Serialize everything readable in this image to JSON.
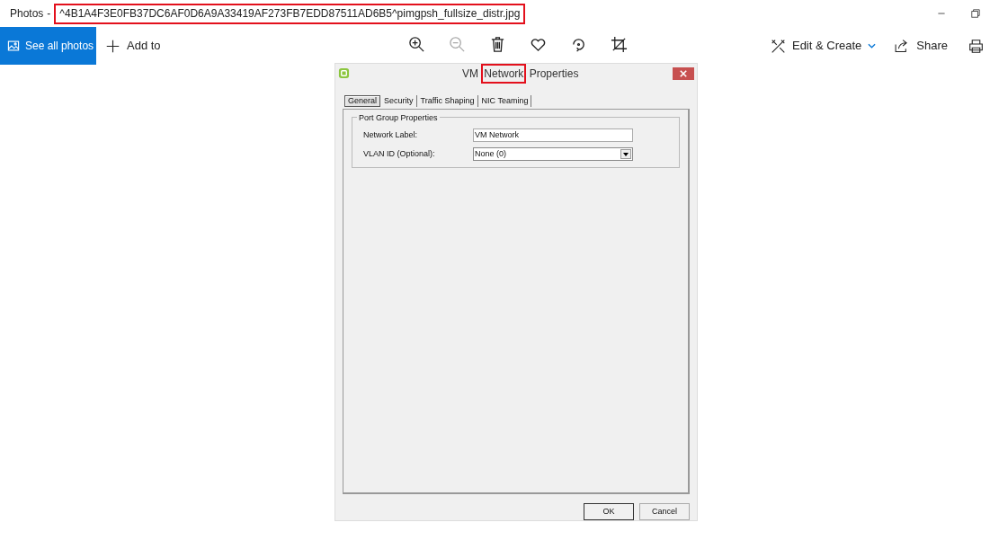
{
  "window": {
    "app": "Photos",
    "separator": "-",
    "filename": "^4B1A4F3E0FB37DC6AF0D6A9A33419AF273FB7EDD87511AD6B5^pimgpsh_fullsize_distr.jpg",
    "filename_highlighted": true
  },
  "toolbar": {
    "see_all": "See all photos",
    "add_to": "Add to",
    "edit_create": "Edit & Create",
    "share": "Share",
    "icons": [
      {
        "kind": "zoom-in",
        "disabled": false
      },
      {
        "kind": "zoom-out",
        "disabled": true
      },
      {
        "kind": "delete",
        "disabled": false
      },
      {
        "kind": "favorite",
        "disabled": false
      },
      {
        "kind": "rotate",
        "disabled": false
      },
      {
        "kind": "crop",
        "disabled": false
      }
    ]
  },
  "dialog": {
    "title_parts": [
      {
        "text": "VM ",
        "highlighted": false
      },
      {
        "text": "Network",
        "highlighted": true
      },
      {
        "text": " Properties",
        "highlighted": false
      }
    ],
    "tabs": [
      {
        "label": "General",
        "selected": true
      },
      {
        "label": "Security",
        "selected": false
      },
      {
        "label": "Traffic Shaping",
        "selected": false
      },
      {
        "label": "NIC Teaming",
        "selected": false
      }
    ],
    "group": "Port Group Properties",
    "fields": [
      {
        "label": "Network Label:",
        "value": "VM Network",
        "kind": "text"
      },
      {
        "label": "VLAN ID (Optional):",
        "value": "None (0)",
        "kind": "dropdown"
      }
    ],
    "buttons": [
      "OK",
      "Cancel"
    ]
  }
}
